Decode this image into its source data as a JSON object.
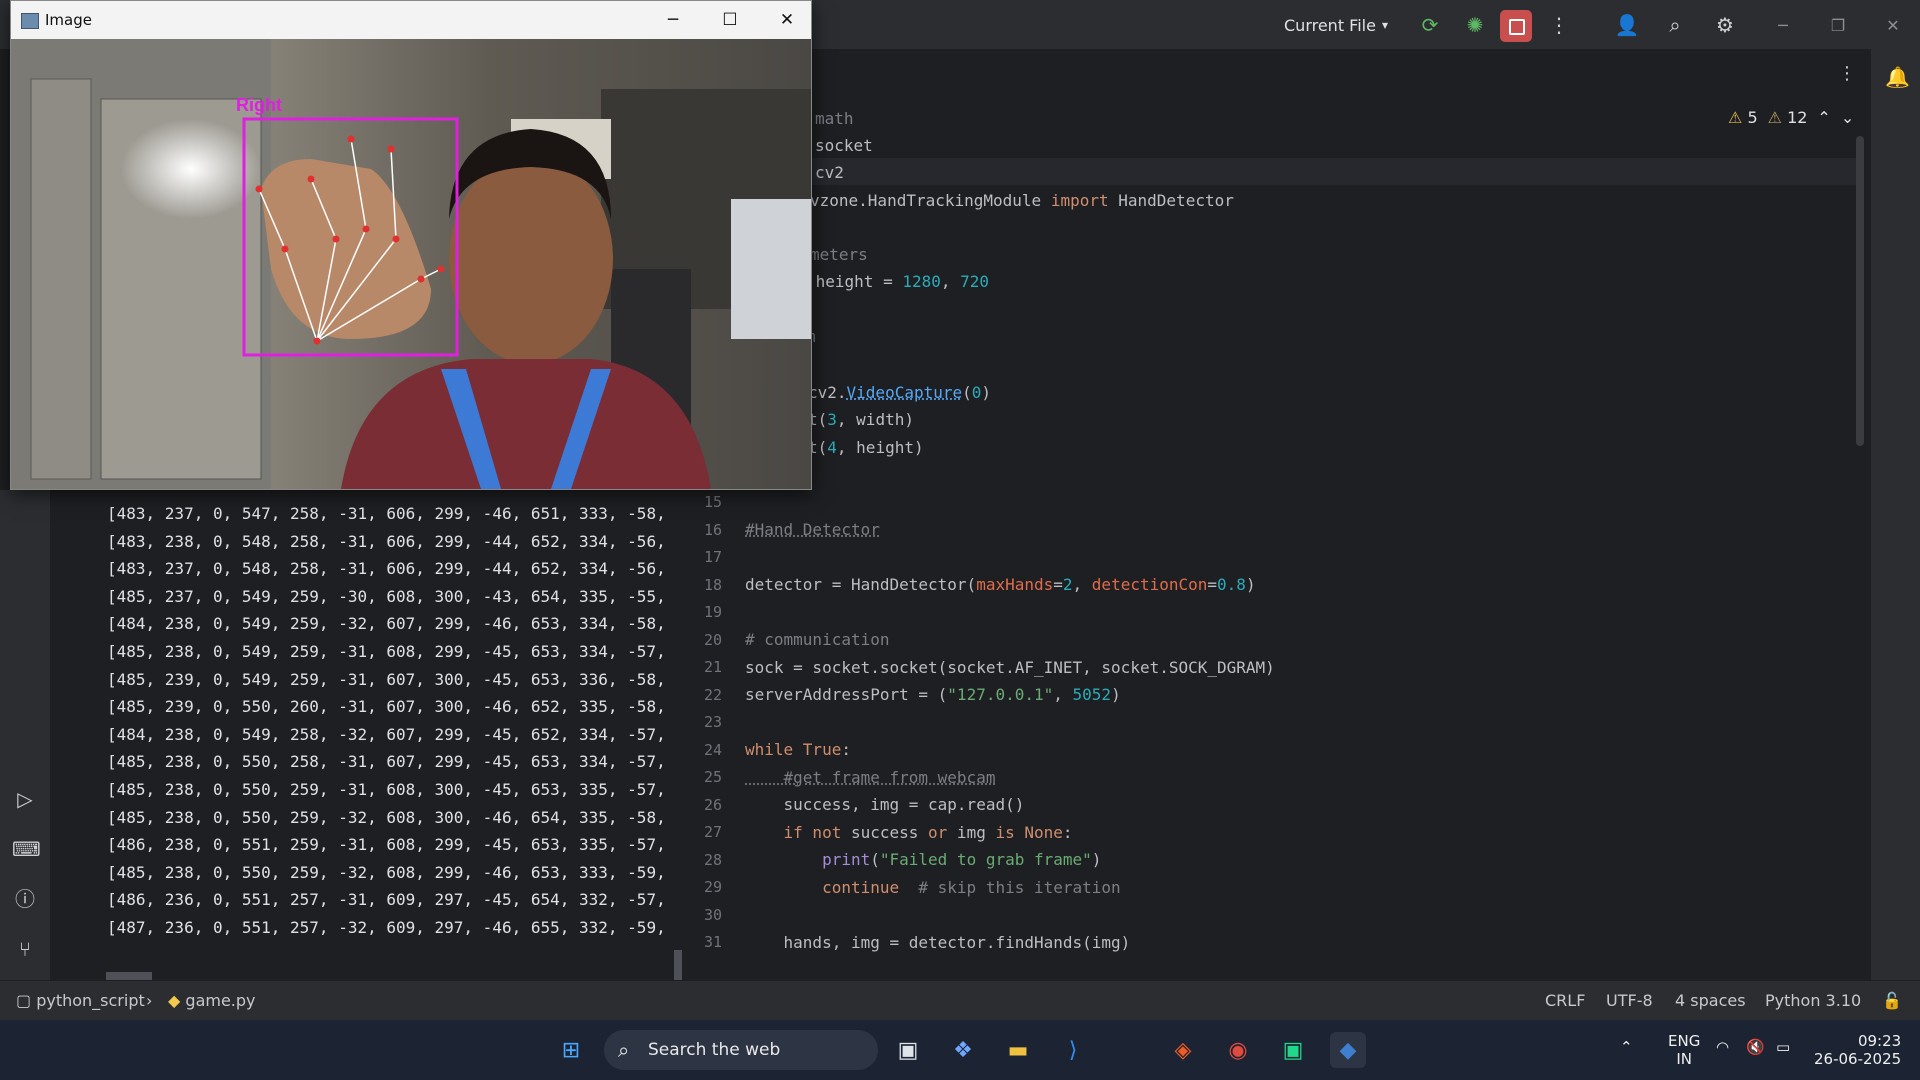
{
  "titlebar": {
    "run_config": "Current File",
    "run_config_chevron": "chevron-down-icon"
  },
  "editor": {
    "warnings": {
      "warning_count": "5",
      "weak_warning_count": "12"
    },
    "lines": [
      {
        "n": "",
        "html": "<span class=\"kw\">import</span> math",
        "visible": "math"
      },
      {
        "n": "",
        "visible": "socket"
      },
      {
        "n": "",
        "visible": "cv2"
      },
      {
        "n": "",
        "visible": "vzone.HandTrackingModule import HandDetector"
      },
      {
        "n": "",
        "visible": ""
      },
      {
        "n": "",
        "visible": "meters"
      },
      {
        "n": "",
        "visible": " height = 1280, 720"
      },
      {
        "n": "",
        "visible": ""
      },
      {
        "n": "",
        "visible": "n"
      },
      {
        "n": "",
        "visible": ""
      },
      {
        "n": "",
        "visible": "cv2.VideoCapture(0)"
      },
      {
        "n": "",
        "visible": "t(3, width)"
      },
      {
        "n": "",
        "visible": "t(4, height)"
      }
    ],
    "code_15_31": {
      "l15": "",
      "l16": "#Hand Detector",
      "l17": "",
      "l18a": "detector = HandDetector(",
      "l18b": "maxHands",
      "l18c": "=",
      "l18d": "2",
      "l18e": ", ",
      "l18f": "detectionCon",
      "l18g": "=",
      "l18h": "0.8",
      "l18i": ")",
      "l19": "",
      "l20": "# communication",
      "l21": "sock = socket.socket(socket.AF_INET, socket.SOCK_DGRAM)",
      "l22a": "serverAddressPort = (",
      "l22b": "\"127.0.0.1\"",
      "l22c": ", ",
      "l22d": "5052",
      "l22e": ")",
      "l23": "",
      "l24a": "while True",
      "l24b": ":",
      "l25": "    #get frame from webcam",
      "l26": "    success, img = cap.read()",
      "l27a": "    if not",
      "l27b": " success ",
      "l27c": "or",
      "l27d": " img ",
      "l27e": "is None",
      "l27f": ":",
      "l28a": "        ",
      "l28b": "print",
      "l28c": "(",
      "l28d": "\"Failed to grab frame\"",
      "l28e": ")",
      "l29a": "        continue",
      "l29b": "  # skip this iteration",
      "l30": "",
      "l31": "    hands, img = detector.findHands(img)"
    },
    "line_numbers": [
      "15",
      "16",
      "17",
      "18",
      "19",
      "20",
      "21",
      "22",
      "23",
      "24",
      "25",
      "26",
      "27",
      "28",
      "29",
      "30",
      "31"
    ],
    "top_code": {
      "t1": "math",
      "t2": "socket",
      "t3": "cv2",
      "t4a": "vzone.HandTrackingModule ",
      "t4b": "import",
      "t4c": " HandDetector",
      "t6": "meters",
      "t7a": " height = ",
      "t7b": "1280",
      "t7c": ", ",
      "t7d": "720",
      "t9": "m",
      "t11a": "cv2.",
      "t11b": "VideoCapture",
      "t11c": "(",
      "t11d": "0",
      "t11e": ")",
      "t12a": "t(",
      "t12b": "3",
      "t12c": ", width)",
      "t13a": "t(",
      "t13b": "4",
      "t13c": ", height)"
    }
  },
  "console": {
    "lines": [
      "[483, 237, 0, 547, 258, -31, 606, 299, -46, 651, 333, -58,",
      "[483, 238, 0, 548, 258, -31, 606, 299, -44, 652, 334, -56,",
      "[483, 237, 0, 548, 258, -31, 606, 299, -44, 652, 334, -56,",
      "[485, 237, 0, 549, 259, -30, 608, 300, -43, 654, 335, -55,",
      "[484, 238, 0, 549, 259, -32, 607, 299, -46, 653, 334, -58,",
      "[485, 238, 0, 549, 259, -31, 608, 299, -45, 653, 334, -57,",
      "[485, 239, 0, 549, 259, -31, 607, 300, -45, 653, 336, -58,",
      "[485, 239, 0, 550, 260, -31, 607, 300, -46, 652, 335, -58,",
      "[484, 238, 0, 549, 258, -32, 607, 299, -45, 652, 334, -57,",
      "[485, 238, 0, 550, 258, -31, 607, 299, -45, 653, 334, -57,",
      "[485, 238, 0, 550, 259, -31, 608, 300, -45, 653, 335, -57,",
      "[485, 238, 0, 550, 259, -32, 608, 300, -46, 654, 335, -58,",
      "[486, 238, 0, 551, 259, -31, 608, 299, -45, 653, 335, -57,",
      "[485, 238, 0, 550, 259, -32, 608, 299, -46, 653, 333, -59,",
      "[486, 236, 0, 551, 257, -31, 609, 297, -45, 654, 332, -57,",
      "[487, 236, 0, 551, 257, -32, 609, 297, -46, 655, 332, -59,"
    ]
  },
  "cv_window": {
    "title": "Image",
    "label": "Right",
    "minimize": "─",
    "maximize": "☐",
    "close": "✕"
  },
  "statusbar": {
    "project": "python_script",
    "file": "game.py",
    "line_sep": "CRLF",
    "encoding": "UTF-8",
    "indent": "4 spaces",
    "interpreter": "Python 3.10"
  },
  "taskbar": {
    "search_placeholder": "Search the web",
    "lang_top": "ENG",
    "lang_bottom": "IN",
    "time": "09:23",
    "date": "26-06-2025"
  },
  "colors": {
    "editor_bg": "#1e1f22",
    "panel_bg": "#2b2d30",
    "keyword": "#cf8e6d",
    "number": "#2aacb8",
    "string": "#6aab73",
    "stop_red": "#c94f4f",
    "bbox_magenta": "#e020e0"
  }
}
